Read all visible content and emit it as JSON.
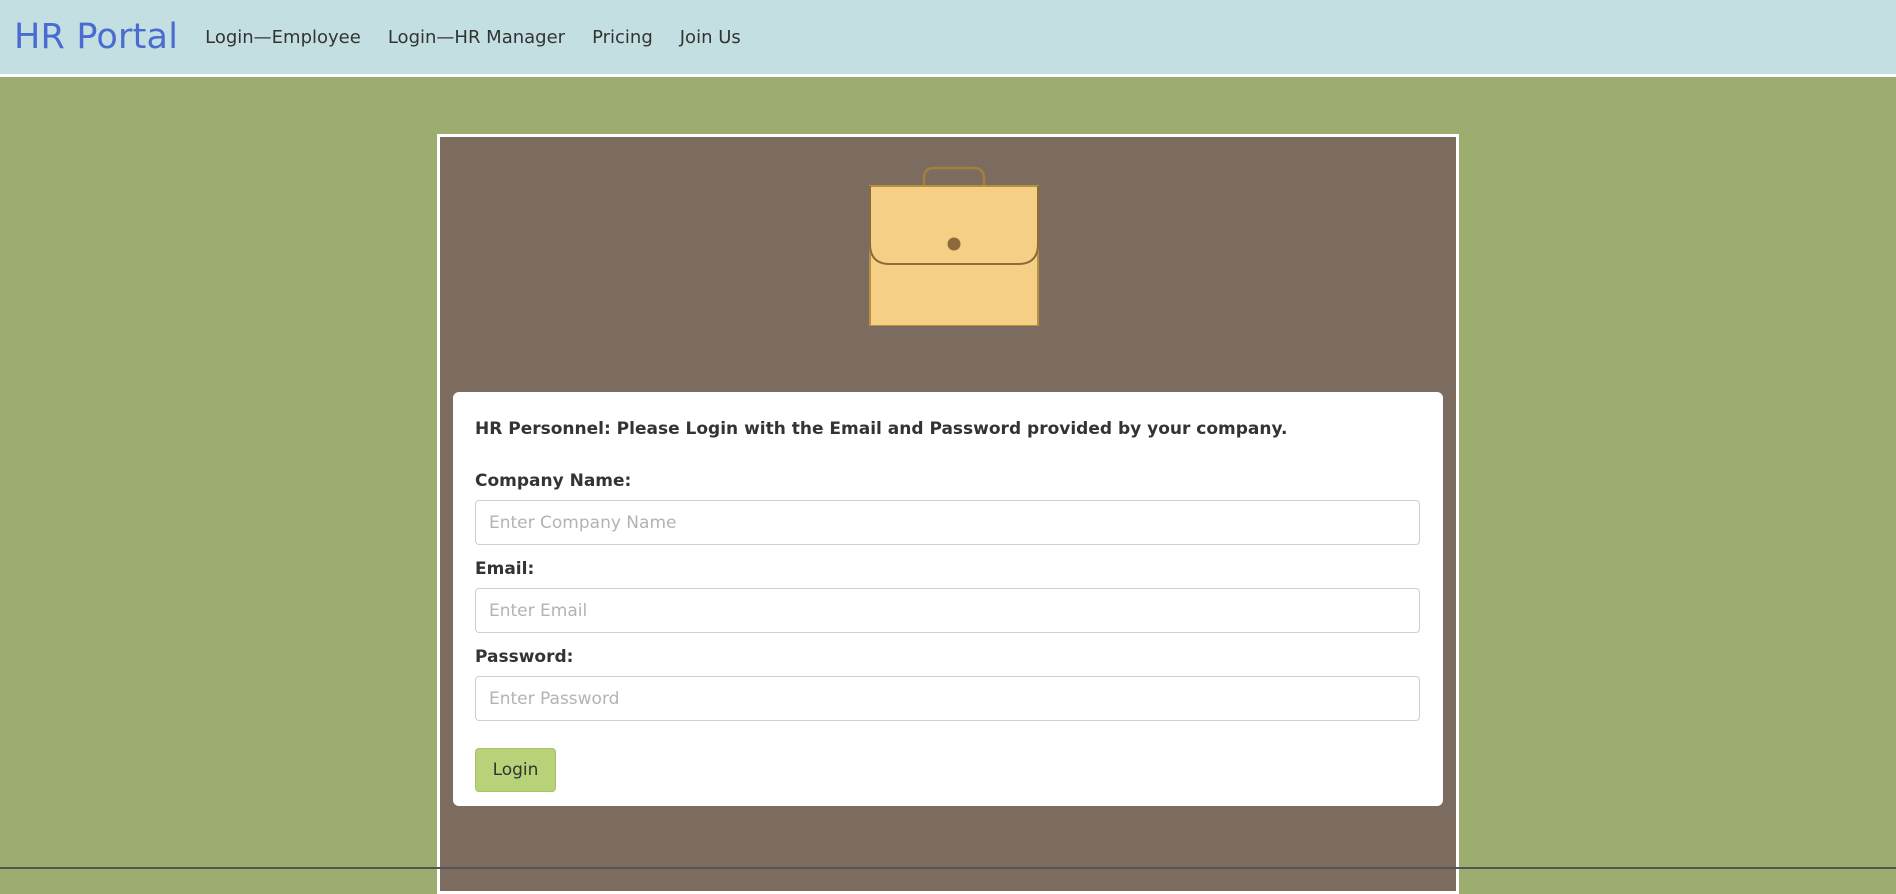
{
  "navbar": {
    "brand": "HR Portal",
    "links": [
      {
        "label": "Login—Employee"
      },
      {
        "label": "Login—HR Manager"
      },
      {
        "label": "Pricing"
      },
      {
        "label": "Join Us"
      }
    ]
  },
  "hero": {
    "icon": "briefcase-icon"
  },
  "login_form": {
    "intro": "HR Personnel: Please Login with the Email and Password provided by your company.",
    "company": {
      "label": "Company Name:",
      "placeholder": "Enter Company Name",
      "value": ""
    },
    "email": {
      "label": "Email:",
      "placeholder": "Enter Email",
      "value": ""
    },
    "password": {
      "label": "Password:",
      "placeholder": "Enter Password",
      "value": ""
    },
    "submit_label": "Login"
  },
  "colors": {
    "page_background": "#9cad6f",
    "navbar_background": "#c3dfe2",
    "brand_text": "#4a6bd0",
    "panel_background": "#7c6b5f",
    "briefcase_fill": "#f6cf87",
    "button_background": "#b8d27a"
  }
}
